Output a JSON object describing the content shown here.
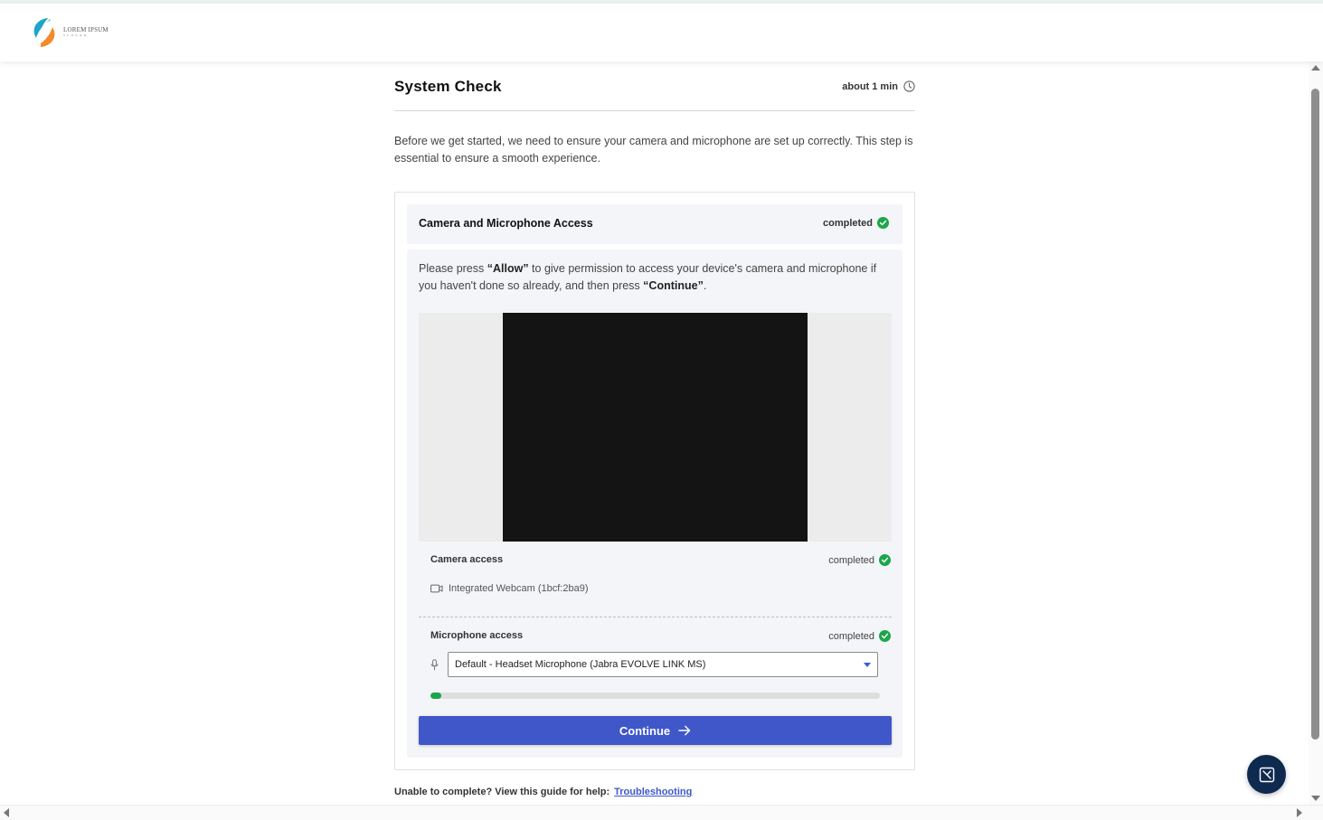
{
  "header": {
    "logo": {
      "name": "LOREM IPSUM",
      "slogan": "SLOGAN"
    }
  },
  "page": {
    "title": "System Check",
    "duration": "about 1 min",
    "intro": "Before we get started, we need to ensure your camera and microphone are set up correctly. This step is essential to ensure a smooth experience."
  },
  "card": {
    "title": "Camera and Microphone Access",
    "status": "completed",
    "instructions": {
      "part1": "Please press ",
      "allow": "“Allow”",
      "part2": " to give permission to access your device's camera and microphone if you haven't done so already, and then press ",
      "continue": "“Continue”",
      "part3": "."
    },
    "camera": {
      "label": "Camera access",
      "status": "completed",
      "device": "Integrated Webcam (1bcf:2ba9)"
    },
    "microphone": {
      "label": "Microphone access",
      "status": "completed",
      "selected": "Default - Headset Microphone (Jabra EVOLVE LINK MS)",
      "level_fraction": 0.025
    },
    "continue_label": "Continue"
  },
  "help": {
    "text": "Unable to complete? View this guide for help:",
    "link": "Troubleshooting"
  },
  "colors": {
    "accent": "#3f57c9",
    "success": "#1ba64a",
    "chat_button": "#0f2a4f"
  },
  "icons": [
    "clock-icon",
    "check-circle-icon",
    "webcam-icon",
    "microphone-icon",
    "chevron-down-icon",
    "arrow-right-icon",
    "chat-icon"
  ]
}
